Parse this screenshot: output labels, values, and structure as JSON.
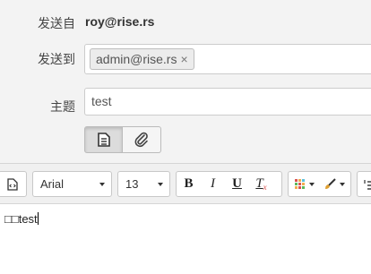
{
  "compose": {
    "from_label": "发送自",
    "from_value": "roy@rise.rs",
    "to_label": "发送到",
    "to_chips": [
      {
        "email": "admin@rise.rs",
        "remove": "×"
      }
    ],
    "subject_label": "主题",
    "subject_value": "test",
    "icons": {
      "editor_mode": "document-icon",
      "attach": "paperclip-icon"
    }
  },
  "toolbar": {
    "font_family": "Arial",
    "font_size": "13",
    "bold": "B",
    "italic": "I",
    "underline": "U",
    "clear_format": "T",
    "clear_format_sub": "x"
  },
  "editor": {
    "body_text": "□□test"
  },
  "colors": {
    "background": "#f3f3f3",
    "toolbar": "#f0f0f0",
    "clear_format_red": "#d9534f"
  }
}
